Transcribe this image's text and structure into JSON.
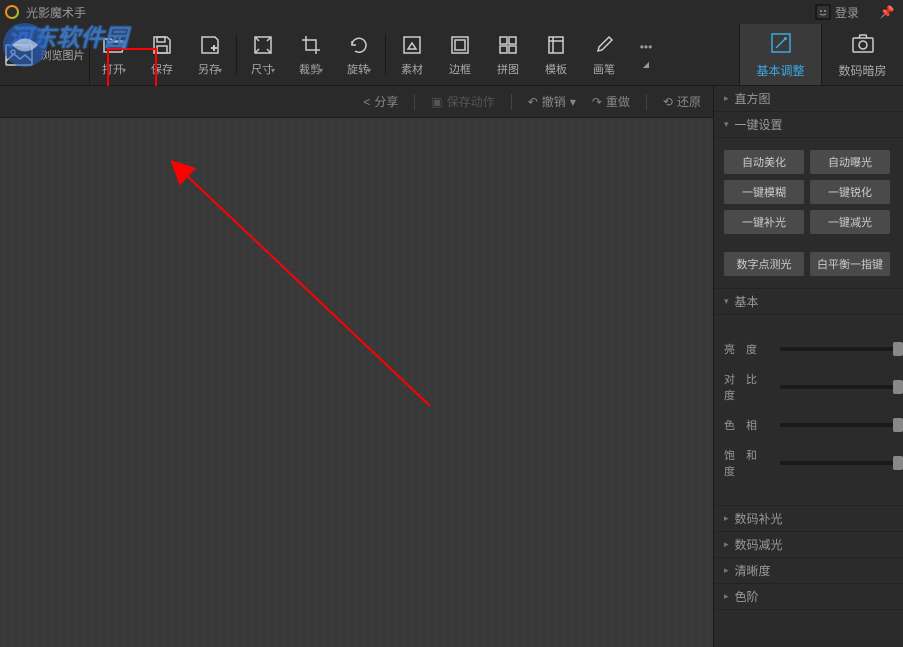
{
  "titlebar": {
    "app_name": "光影魔术手",
    "login_label": "登录"
  },
  "toolbar": {
    "browse": {
      "label": "浏览图片"
    },
    "open": {
      "label": "打开"
    },
    "save": {
      "label": "保存"
    },
    "saveas": {
      "label": "另存"
    },
    "size": {
      "label": "尺寸"
    },
    "crop": {
      "label": "裁剪"
    },
    "rotate": {
      "label": "旋转"
    },
    "material": {
      "label": "素材"
    },
    "border": {
      "label": "边框"
    },
    "collage": {
      "label": "拼图"
    },
    "template": {
      "label": "模板"
    },
    "brush": {
      "label": "画笔"
    }
  },
  "tabs": {
    "basic": {
      "label": "基本调整"
    },
    "darkroom": {
      "label": "数码暗房"
    }
  },
  "subbar": {
    "share": "分享",
    "save_action": "保存动作",
    "undo": "撤销",
    "redo": "重做",
    "revert": "还原"
  },
  "panels": {
    "histogram": {
      "title": "直方图"
    },
    "onekey": {
      "title": "一键设置",
      "buttons": {
        "beautify": "自动美化",
        "exposure": "自动曝光",
        "blur": "一键模糊",
        "sharpen": "一键锐化",
        "fill": "一键补光",
        "darken": "一键减光",
        "spot": "数字点测光",
        "wb": "白平衡一指键"
      }
    },
    "basic": {
      "title": "基本",
      "brightness": "亮    度",
      "contrast": "对 比 度",
      "hue": "色    相",
      "saturation": "饱 和 度"
    },
    "fill_light": {
      "title": "数码补光"
    },
    "darken": {
      "title": "数码减光"
    },
    "clarity": {
      "title": "清晰度"
    },
    "levels": {
      "title": "色阶"
    }
  },
  "watermark": {
    "text": "河东软件园"
  }
}
